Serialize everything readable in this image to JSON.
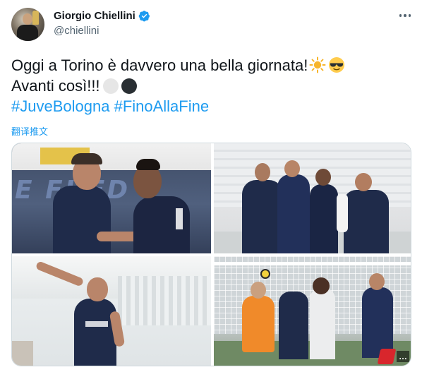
{
  "author": {
    "display_name": "Giorgio Chiellini",
    "handle": "@chiellini",
    "verified": true
  },
  "tweet": {
    "line1": "Oggi a Torino è davvero una bella giornata!",
    "line2": "Avanti così!!!",
    "hashtags": [
      "#JuveBologna",
      "#FinoAllaFine"
    ],
    "translate_label": "翻译推文"
  },
  "media": {
    "photo_count": 4,
    "board_text": "E FI ED",
    "watermark_text": "…"
  },
  "colors": {
    "link": "#1d9bf0",
    "text": "#0f1419",
    "secondary": "#536471",
    "juve_navy": "#1f2b4a"
  },
  "icons": {
    "verified": "verified-badge-icon",
    "more": "more-options-icon",
    "sun": "sun-emoji",
    "cool": "sunglasses-emoji"
  }
}
